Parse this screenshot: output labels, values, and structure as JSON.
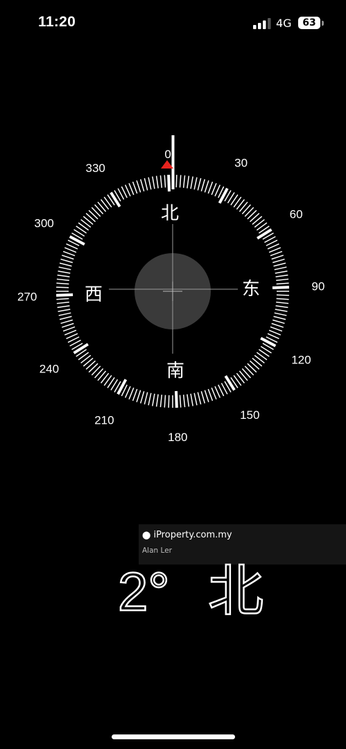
{
  "status_bar": {
    "time": "11:20",
    "network": "4G",
    "battery": "63"
  },
  "compass": {
    "heading_degrees": 2,
    "degree_labels": [
      "0",
      "30",
      "60",
      "90",
      "120",
      "150",
      "180",
      "210",
      "240",
      "270",
      "300",
      "330"
    ],
    "cardinals": {
      "north": "北",
      "east": "东",
      "south": "南",
      "west": "西"
    },
    "heading_marker_color": "#e8231e"
  },
  "watermark": {
    "brand": "iProperty.com.my",
    "author": "Alan Ler"
  },
  "readout": {
    "degrees": "2°",
    "direction": "北"
  }
}
